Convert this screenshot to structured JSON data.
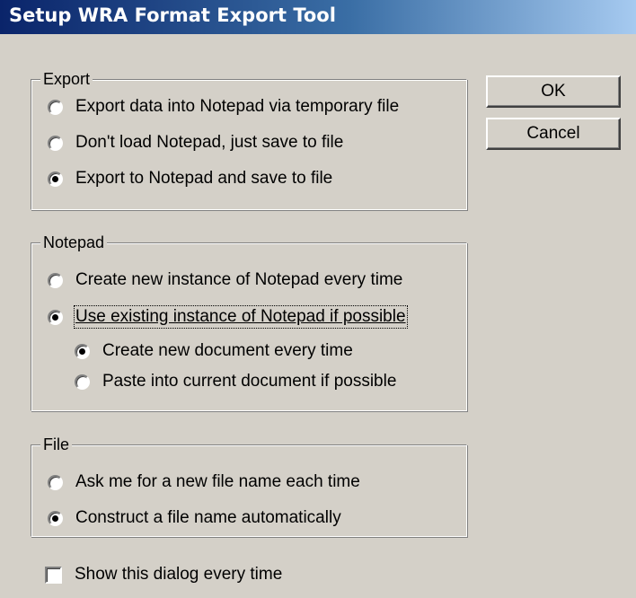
{
  "window": {
    "title": "Setup WRA Format Export Tool"
  },
  "buttons": {
    "ok": "OK",
    "cancel": "Cancel"
  },
  "export_group": {
    "label": "Export",
    "options": [
      {
        "label": "Export data into Notepad via temporary file",
        "checked": false
      },
      {
        "label": "Don't load Notepad, just save to file",
        "checked": false
      },
      {
        "label": "Export to Notepad and save to file",
        "checked": true
      }
    ]
  },
  "notepad_group": {
    "label": "Notepad",
    "options": [
      {
        "label": "Create new instance of Notepad every time",
        "checked": false
      },
      {
        "label": "Use existing instance of Notepad if possible",
        "checked": true,
        "focused": true
      }
    ],
    "sub_options": [
      {
        "label": "Create new document every time",
        "checked": true
      },
      {
        "label": "Paste into current document if possible",
        "checked": false
      }
    ]
  },
  "file_group": {
    "label": "File",
    "options": [
      {
        "label": "Ask me for a new file name each time",
        "checked": false
      },
      {
        "label": "Construct a file name automatically",
        "checked": true
      }
    ]
  },
  "show_dialog": {
    "label": "Show this dialog every time",
    "checked": false
  },
  "colors": {
    "face": "#d4d0c8",
    "title_start": "#0a246a",
    "title_end": "#a6caf0"
  }
}
